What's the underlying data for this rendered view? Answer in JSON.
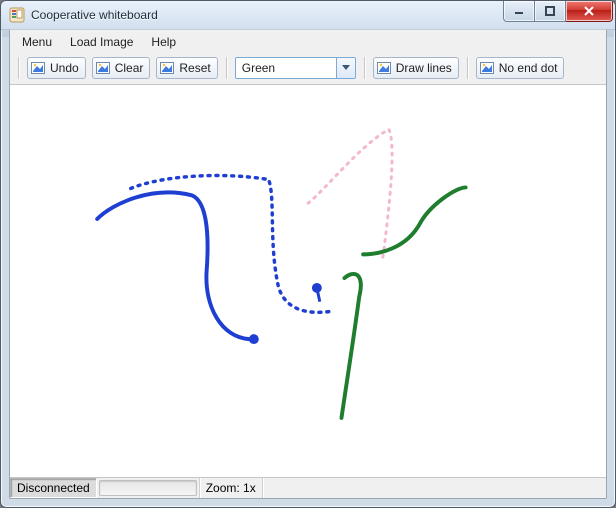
{
  "window": {
    "title": "Cooperative whiteboard"
  },
  "menubar": {
    "items": [
      "Menu",
      "Load Image",
      "Help"
    ]
  },
  "toolbar": {
    "undo": "Undo",
    "clear": "Clear",
    "reset": "Reset",
    "drawlines": "Draw lines",
    "noenddot": "No end dot",
    "color_selected": "Green"
  },
  "status": {
    "connection": "Disconnected",
    "zoom": "Zoom:  1x"
  },
  "icons": {
    "app": "form-icon",
    "minimize": "minimize-icon",
    "maximize": "maximize-icon",
    "close": "close-icon",
    "picture": "picture-icon",
    "dropdown": "chevron-down-icon"
  },
  "colors": {
    "stroke_blue": "#1e3fd1",
    "stroke_green": "#1f7d2e",
    "stroke_pink": "#f4b8cc",
    "accent": "#7ba9d8",
    "close_red": "#c8362d"
  }
}
